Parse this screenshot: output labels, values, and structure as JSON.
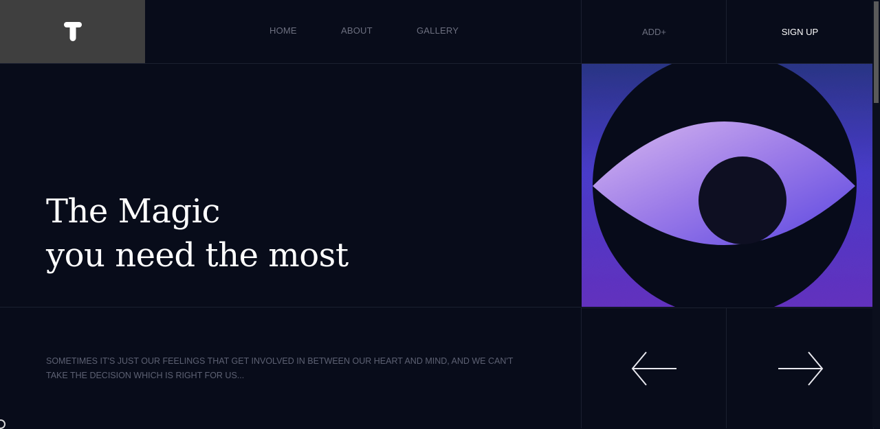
{
  "header": {
    "logo_letter": "T",
    "nav": [
      {
        "label": "HOME"
      },
      {
        "label": "ABOUT"
      },
      {
        "label": "GALLERY"
      }
    ],
    "add_label": "ADD+",
    "signup_label": "SIGN UP"
  },
  "hero": {
    "title_line1": "The Magic",
    "title_line2": "you need the most"
  },
  "footer": {
    "description": "SOMETIMES IT'S JUST OUR FEELINGS THAT GET INVOLVED IN BETWEEN OUR HEART AND MIND, AND WE CAN'T TAKE THE DECISION WHICH IS RIGHT FOR US..."
  },
  "icons": {
    "logo": "t-logo-icon",
    "prev": "arrow-left-icon",
    "next": "arrow-right-icon",
    "art": "eye-illustration"
  },
  "colors": {
    "background": "#080c1a",
    "logo_box": "#3f3f3f",
    "muted_text": "#6d7080",
    "accent_purple": "#6a4fe0"
  }
}
